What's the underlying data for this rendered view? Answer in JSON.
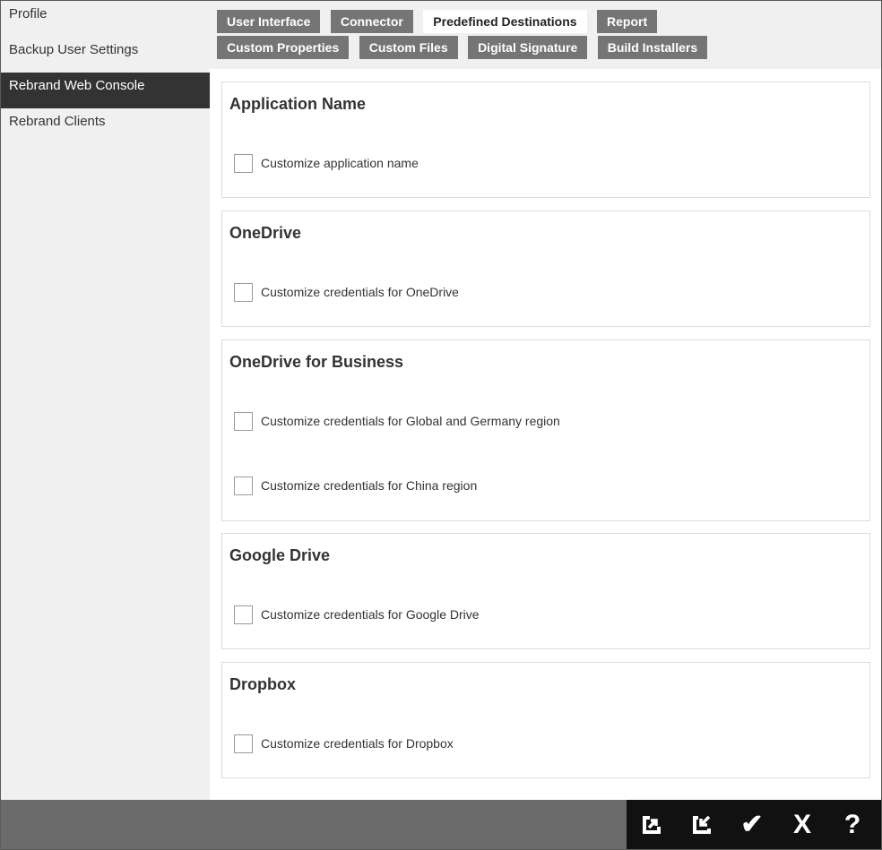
{
  "sidebar": {
    "items": [
      {
        "label": "Profile"
      },
      {
        "label": "Backup User Settings"
      },
      {
        "label": "Rebrand Web Console"
      },
      {
        "label": "Rebrand Clients"
      }
    ],
    "active_index": 2
  },
  "tabs": {
    "row1": [
      {
        "label": "User Interface"
      },
      {
        "label": "Connector"
      },
      {
        "label": "Predefined Destinations"
      },
      {
        "label": "Report"
      }
    ],
    "row2": [
      {
        "label": "Custom Properties"
      },
      {
        "label": "Custom Files"
      },
      {
        "label": "Digital Signature"
      },
      {
        "label": "Build Installers"
      }
    ],
    "active": "Predefined Destinations"
  },
  "panels": [
    {
      "title": "Application Name",
      "checkboxes": [
        {
          "label": "Customize application name",
          "checked": false
        }
      ]
    },
    {
      "title": "OneDrive",
      "checkboxes": [
        {
          "label": "Customize credentials for OneDrive",
          "checked": false
        }
      ]
    },
    {
      "title": "OneDrive for Business",
      "checkboxes": [
        {
          "label": "Customize credentials for Global and Germany region",
          "checked": false
        },
        {
          "label": "Customize credentials for China region",
          "checked": false
        }
      ]
    },
    {
      "title": "Google Drive",
      "checkboxes": [
        {
          "label": "Customize credentials for Google Drive",
          "checked": false
        }
      ]
    },
    {
      "title": "Dropbox",
      "checkboxes": [
        {
          "label": "Customize credentials for Dropbox",
          "checked": false
        }
      ]
    }
  ],
  "footer": {
    "buttons": [
      {
        "icon": "export-icon"
      },
      {
        "icon": "import-icon"
      },
      {
        "icon": "check-icon",
        "glyph": "✔"
      },
      {
        "icon": "close-icon",
        "glyph": "X"
      },
      {
        "icon": "help-icon",
        "glyph": "?"
      }
    ]
  }
}
